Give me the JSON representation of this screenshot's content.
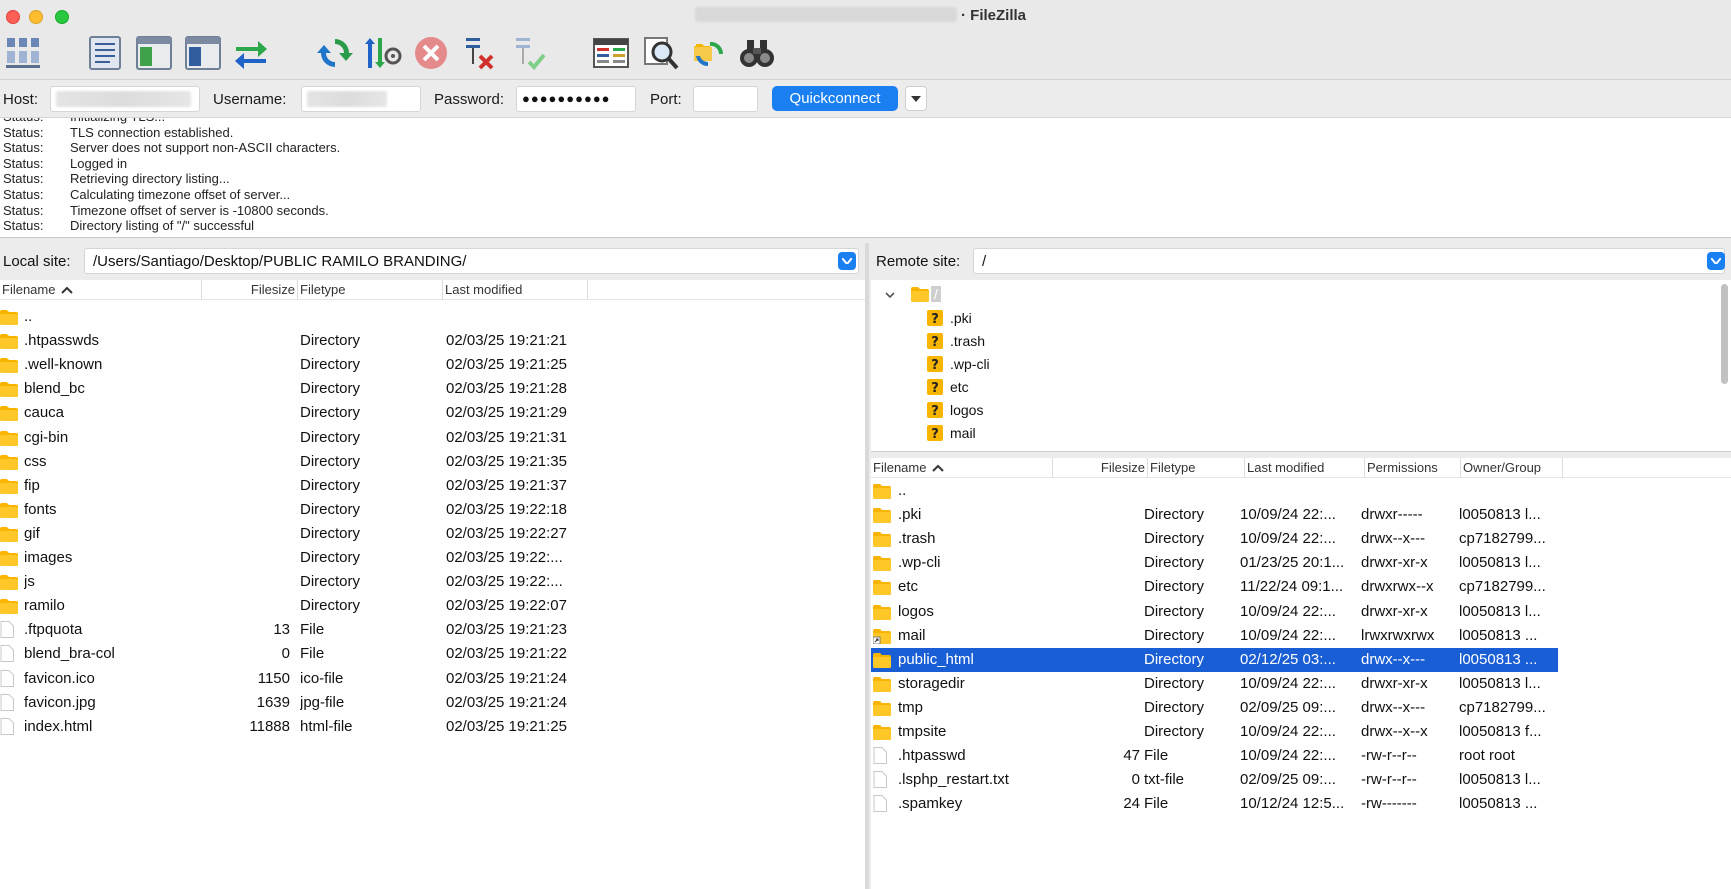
{
  "window": {
    "title_suffix": "· FileZilla"
  },
  "toolbar": {
    "icons": [
      "site-manager-icon",
      "toggle-message-log-icon",
      "toggle-local-tree-icon",
      "toggle-remote-tree-icon",
      "transfer-queue-icon",
      "refresh-icon",
      "process-queue-icon",
      "cancel-icon",
      "disconnect-icon",
      "reconnect-icon",
      "directory-comparison-icon",
      "search-files-icon",
      "sync-browsing-icon",
      "find-binoculars-icon"
    ]
  },
  "quickconnect": {
    "host_label": "Host:",
    "username_label": "Username:",
    "password_label": "Password:",
    "password_value": "●●●●●●●●●●",
    "port_label": "Port:",
    "button_label": "Quickconnect"
  },
  "log": [
    {
      "type": "Status:",
      "msg": "Initializing TLS..."
    },
    {
      "type": "Status:",
      "msg": "TLS connection established."
    },
    {
      "type": "Status:",
      "msg": "Server does not support non-ASCII characters."
    },
    {
      "type": "Status:",
      "msg": "Logged in"
    },
    {
      "type": "Status:",
      "msg": "Retrieving directory listing..."
    },
    {
      "type": "Status:",
      "msg": "Calculating timezone offset of server..."
    },
    {
      "type": "Status:",
      "msg": "Timezone offset of server is -10800 seconds."
    },
    {
      "type": "Status:",
      "msg": "Directory listing of \"/\" successful"
    }
  ],
  "local": {
    "site_label": "Local site:",
    "path": "/Users/Santiago/Desktop/PUBLIC RAMILO BRANDING/",
    "columns": {
      "filename": "Filename",
      "filesize": "Filesize",
      "filetype": "Filetype",
      "modified": "Last modified"
    },
    "rows": [
      {
        "name": "..",
        "size": "",
        "type": "",
        "modified": "",
        "kind": "folder"
      },
      {
        "name": ".htpasswds",
        "size": "",
        "type": "Directory",
        "modified": "02/03/25 19:21:21",
        "kind": "folder"
      },
      {
        "name": ".well-known",
        "size": "",
        "type": "Directory",
        "modified": "02/03/25 19:21:25",
        "kind": "folder"
      },
      {
        "name": "blend_bc",
        "size": "",
        "type": "Directory",
        "modified": "02/03/25 19:21:28",
        "kind": "folder"
      },
      {
        "name": "cauca",
        "size": "",
        "type": "Directory",
        "modified": "02/03/25 19:21:29",
        "kind": "folder"
      },
      {
        "name": "cgi-bin",
        "size": "",
        "type": "Directory",
        "modified": "02/03/25 19:21:31",
        "kind": "folder"
      },
      {
        "name": "css",
        "size": "",
        "type": "Directory",
        "modified": "02/03/25 19:21:35",
        "kind": "folder"
      },
      {
        "name": "fip",
        "size": "",
        "type": "Directory",
        "modified": "02/03/25 19:21:37",
        "kind": "folder"
      },
      {
        "name": "fonts",
        "size": "",
        "type": "Directory",
        "modified": "02/03/25 19:22:18",
        "kind": "folder"
      },
      {
        "name": "gif",
        "size": "",
        "type": "Directory",
        "modified": "02/03/25 19:22:27",
        "kind": "folder"
      },
      {
        "name": "images",
        "size": "",
        "type": "Directory",
        "modified": "02/03/25 19:22:...",
        "kind": "folder"
      },
      {
        "name": "js",
        "size": "",
        "type": "Directory",
        "modified": "02/03/25 19:22:...",
        "kind": "folder"
      },
      {
        "name": "ramilo",
        "size": "",
        "type": "Directory",
        "modified": "02/03/25 19:22:07",
        "kind": "folder"
      },
      {
        "name": ".ftpquota",
        "size": "13",
        "type": "File",
        "modified": "02/03/25 19:21:23",
        "kind": "file"
      },
      {
        "name": "blend_bra-col",
        "size": "0",
        "type": "File",
        "modified": "02/03/25 19:21:22",
        "kind": "file"
      },
      {
        "name": "favicon.ico",
        "size": "1150",
        "type": "ico-file",
        "modified": "02/03/25 19:21:24",
        "kind": "file"
      },
      {
        "name": "favicon.jpg",
        "size": "1639",
        "type": "jpg-file",
        "modified": "02/03/25 19:21:24",
        "kind": "file"
      },
      {
        "name": "index.html",
        "size": "11888",
        "type": "html-file",
        "modified": "02/03/25 19:21:25",
        "kind": "file"
      }
    ]
  },
  "remote": {
    "site_label": "Remote site:",
    "path": "/",
    "tree": {
      "root": "/",
      "items": [
        ".pki",
        ".trash",
        ".wp-cli",
        "etc",
        "logos",
        "mail"
      ]
    },
    "columns": {
      "filename": "Filename",
      "filesize": "Filesize",
      "filetype": "Filetype",
      "modified": "Last modified",
      "permissions": "Permissions",
      "owner": "Owner/Group"
    },
    "rows": [
      {
        "name": "..",
        "size": "",
        "type": "",
        "modified": "",
        "perms": "",
        "owner": "",
        "kind": "folder"
      },
      {
        "name": ".pki",
        "size": "",
        "type": "Directory",
        "modified": "10/09/24 22:...",
        "perms": "drwxr-----",
        "owner": "l0050813 l...",
        "kind": "folder"
      },
      {
        "name": ".trash",
        "size": "",
        "type": "Directory",
        "modified": "10/09/24 22:...",
        "perms": "drwx--x---",
        "owner": "cp7182799...",
        "kind": "folder"
      },
      {
        "name": ".wp-cli",
        "size": "",
        "type": "Directory",
        "modified": "01/23/25 20:1...",
        "perms": "drwxr-xr-x",
        "owner": "l0050813 l...",
        "kind": "folder"
      },
      {
        "name": "etc",
        "size": "",
        "type": "Directory",
        "modified": "11/22/24 09:1...",
        "perms": "drwxrwx--x",
        "owner": "cp7182799...",
        "kind": "folder"
      },
      {
        "name": "logos",
        "size": "",
        "type": "Directory",
        "modified": "10/09/24 22:...",
        "perms": "drwxr-xr-x",
        "owner": "l0050813 l...",
        "kind": "folder"
      },
      {
        "name": "mail",
        "size": "",
        "type": "Directory",
        "modified": "10/09/24 22:...",
        "perms": "lrwxrwxrwx",
        "owner": "l0050813 ...",
        "kind": "link"
      },
      {
        "name": "public_html",
        "size": "",
        "type": "Directory",
        "modified": "02/12/25 03:...",
        "perms": "drwx--x---",
        "owner": "l0050813 ...",
        "kind": "folder",
        "selected": true
      },
      {
        "name": "storagedir",
        "size": "",
        "type": "Directory",
        "modified": "10/09/24 22:...",
        "perms": "drwxr-xr-x",
        "owner": "l0050813 l...",
        "kind": "folder"
      },
      {
        "name": "tmp",
        "size": "",
        "type": "Directory",
        "modified": "02/09/25 09:...",
        "perms": "drwx--x---",
        "owner": "cp7182799...",
        "kind": "folder"
      },
      {
        "name": "tmpsite",
        "size": "",
        "type": "Directory",
        "modified": "10/09/24 22:...",
        "perms": "drwx--x--x",
        "owner": "l0050813 f...",
        "kind": "folder"
      },
      {
        "name": ".htpasswd",
        "size": "47",
        "type": "File",
        "modified": "10/09/24 22:...",
        "perms": "-rw-r--r--",
        "owner": "root root",
        "kind": "file"
      },
      {
        "name": ".lsphp_restart.txt",
        "size": "0",
        "type": "txt-file",
        "modified": "02/09/25 09:...",
        "perms": "-rw-r--r--",
        "owner": "l0050813 l...",
        "kind": "file"
      },
      {
        "name": ".spamkey",
        "size": "24",
        "type": "File",
        "modified": "10/12/24 12:5...",
        "perms": "-rw-------",
        "owner": "l0050813 ...",
        "kind": "file"
      }
    ]
  },
  "colors": {
    "accent": "#1a7ff0",
    "selection": "#1a5ed6",
    "folder": "#f7b500"
  }
}
